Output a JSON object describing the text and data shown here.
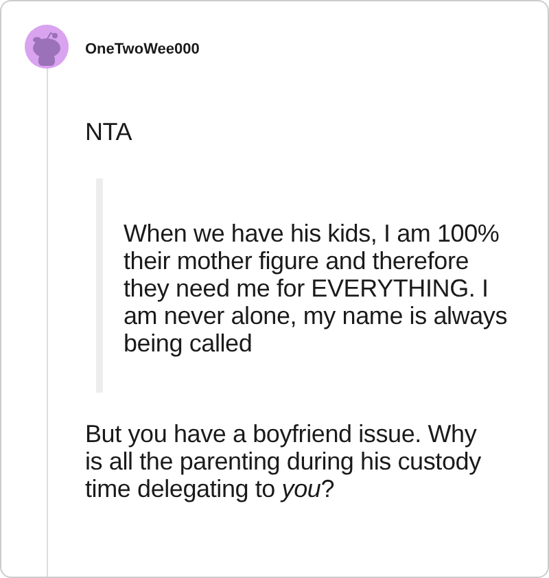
{
  "comment": {
    "author": "OneTwoWee000",
    "paragraphs": [
      {
        "kind": "text",
        "text": "NTA"
      },
      {
        "kind": "quote",
        "text": "When we have his kids, I am 100% their mother figure and therefore they need me for EVERYTHING. I am never alone, my name is always being called"
      },
      {
        "kind": "text",
        "text": "But you have a boyfriend issue. Why is all the parenting during his custody time delegating to *you*?"
      }
    ]
  }
}
